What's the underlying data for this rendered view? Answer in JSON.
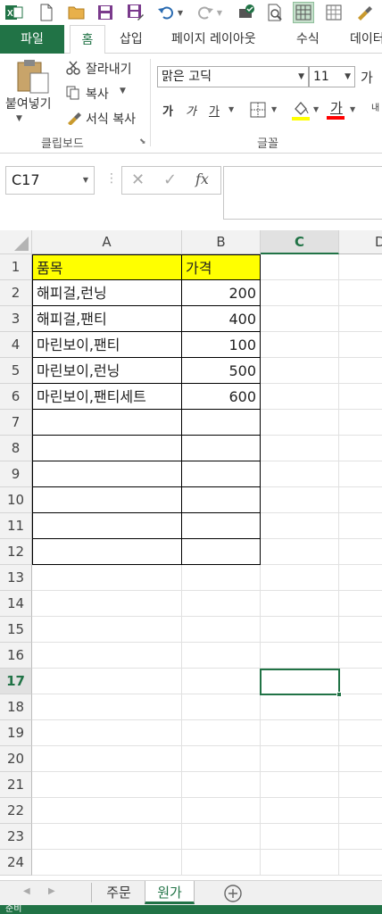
{
  "qat": {
    "excel_icon": "excel-logo-icon",
    "new_icon": "new-file-icon",
    "open_icon": "open-folder-icon",
    "save_icon": "save-icon",
    "save_as_icon": "save-as-icon",
    "undo_icon": "undo-icon",
    "redo_icon": "redo-icon"
  },
  "tabs": [
    "파일",
    "홈",
    "삽입",
    "페이지 레이아웃",
    "수식",
    "데이터"
  ],
  "ribbon": {
    "paste_label": "붙여넣기",
    "cut_label": "잘라내기",
    "copy_label": "복사",
    "format_painter_label": "서식 복사",
    "clipboard_group": "클립보드",
    "font_name": "맑은 고딕",
    "font_size": "11",
    "grow_font": "가",
    "bold": "가",
    "italic": "가",
    "underline": "가",
    "font_color_glyph": "가",
    "wrap_glyph": "내",
    "font_group": "글꼴",
    "highlight_color": "#ffff00",
    "font_color": "#ff0000"
  },
  "formula_bar": {
    "name_box": "C17",
    "cancel": "✕",
    "enter": "✓",
    "fx": "fx",
    "content": ""
  },
  "sheet": {
    "columns": [
      "A",
      "B",
      "C",
      "D"
    ],
    "rows": [
      "1",
      "2",
      "3",
      "4",
      "5",
      "6",
      "7",
      "8",
      "9",
      "10",
      "11",
      "12",
      "13",
      "14",
      "15",
      "16",
      "17",
      "18",
      "19",
      "20",
      "21",
      "22",
      "23",
      "24"
    ],
    "active_cell": "C17",
    "header_fill": "#ffff00",
    "cells": [
      [
        "품목",
        "가격"
      ],
      [
        "해피걸,런닝",
        "200"
      ],
      [
        "해피걸,팬티",
        "400"
      ],
      [
        "마린보이,팬티",
        "100"
      ],
      [
        "마린보이,런닝",
        "500"
      ],
      [
        "마린보이,팬티세트",
        "600"
      ]
    ]
  },
  "sheet_tabs": [
    "주문",
    "원가"
  ],
  "active_sheet": "원가",
  "status": "준비"
}
